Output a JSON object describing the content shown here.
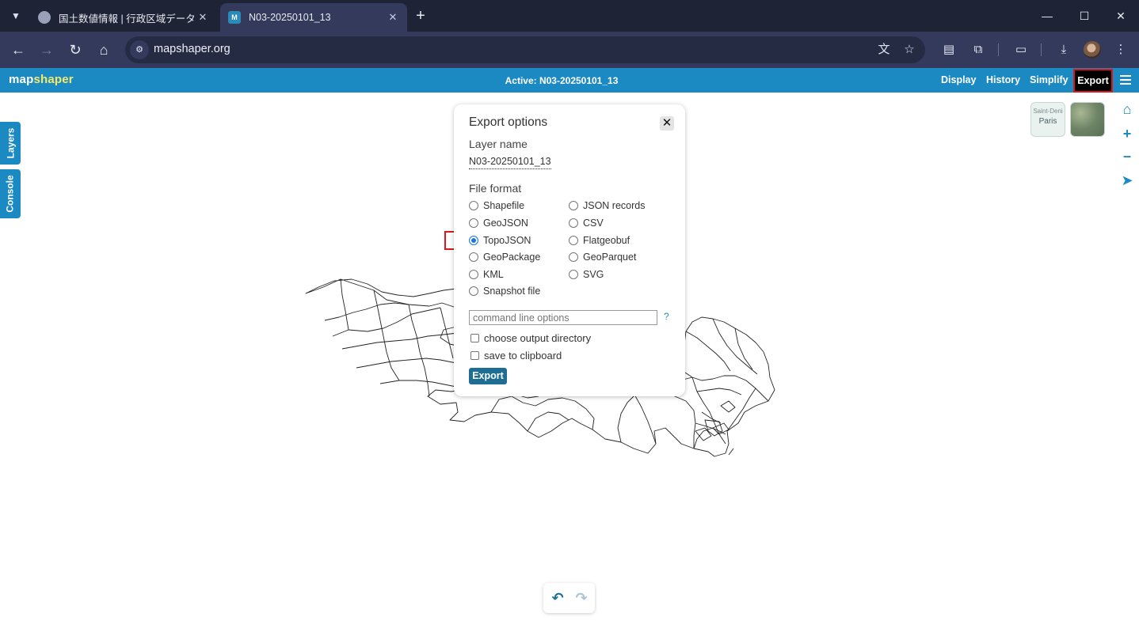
{
  "browser": {
    "tabs": [
      {
        "title": "国土数値情報 | 行政区域データ",
        "close": "✕"
      },
      {
        "title": "N03-20250101_13",
        "close": "✕"
      }
    ],
    "url": "mapshaper.org"
  },
  "app": {
    "logo_map": "map",
    "logo_shaper": "shaper",
    "active_label": "Active: N03-20250101_13",
    "nav": {
      "display": "Display",
      "history": "History",
      "simplify": "Simplify",
      "export": "Export"
    },
    "side_tabs": {
      "layers": "Layers",
      "console": "Console"
    },
    "basemap_streets": {
      "line1": "Saint-Deni",
      "line2": "Paris"
    }
  },
  "export_dialog": {
    "title": "Export options",
    "close": "✕",
    "layer_name_label": "Layer name",
    "layer_name_value": "N03-20250101_13",
    "file_format_label": "File format",
    "formats_left": [
      "Shapefile",
      "GeoJSON",
      "TopoJSON",
      "GeoPackage",
      "KML",
      "Snapshot file"
    ],
    "formats_right": [
      "JSON records",
      "CSV",
      "Flatgeobuf",
      "GeoParquet",
      "SVG"
    ],
    "selected_format": "TopoJSON",
    "cmd_placeholder": "command line options",
    "cmd_help": "?",
    "choose_output_dir": "choose output directory",
    "save_to_clipboard": "save to clipboard",
    "export_button": "Export"
  },
  "colors": {
    "brand_blue": "#1c8ac2",
    "highlight_red": "#e0161b"
  }
}
